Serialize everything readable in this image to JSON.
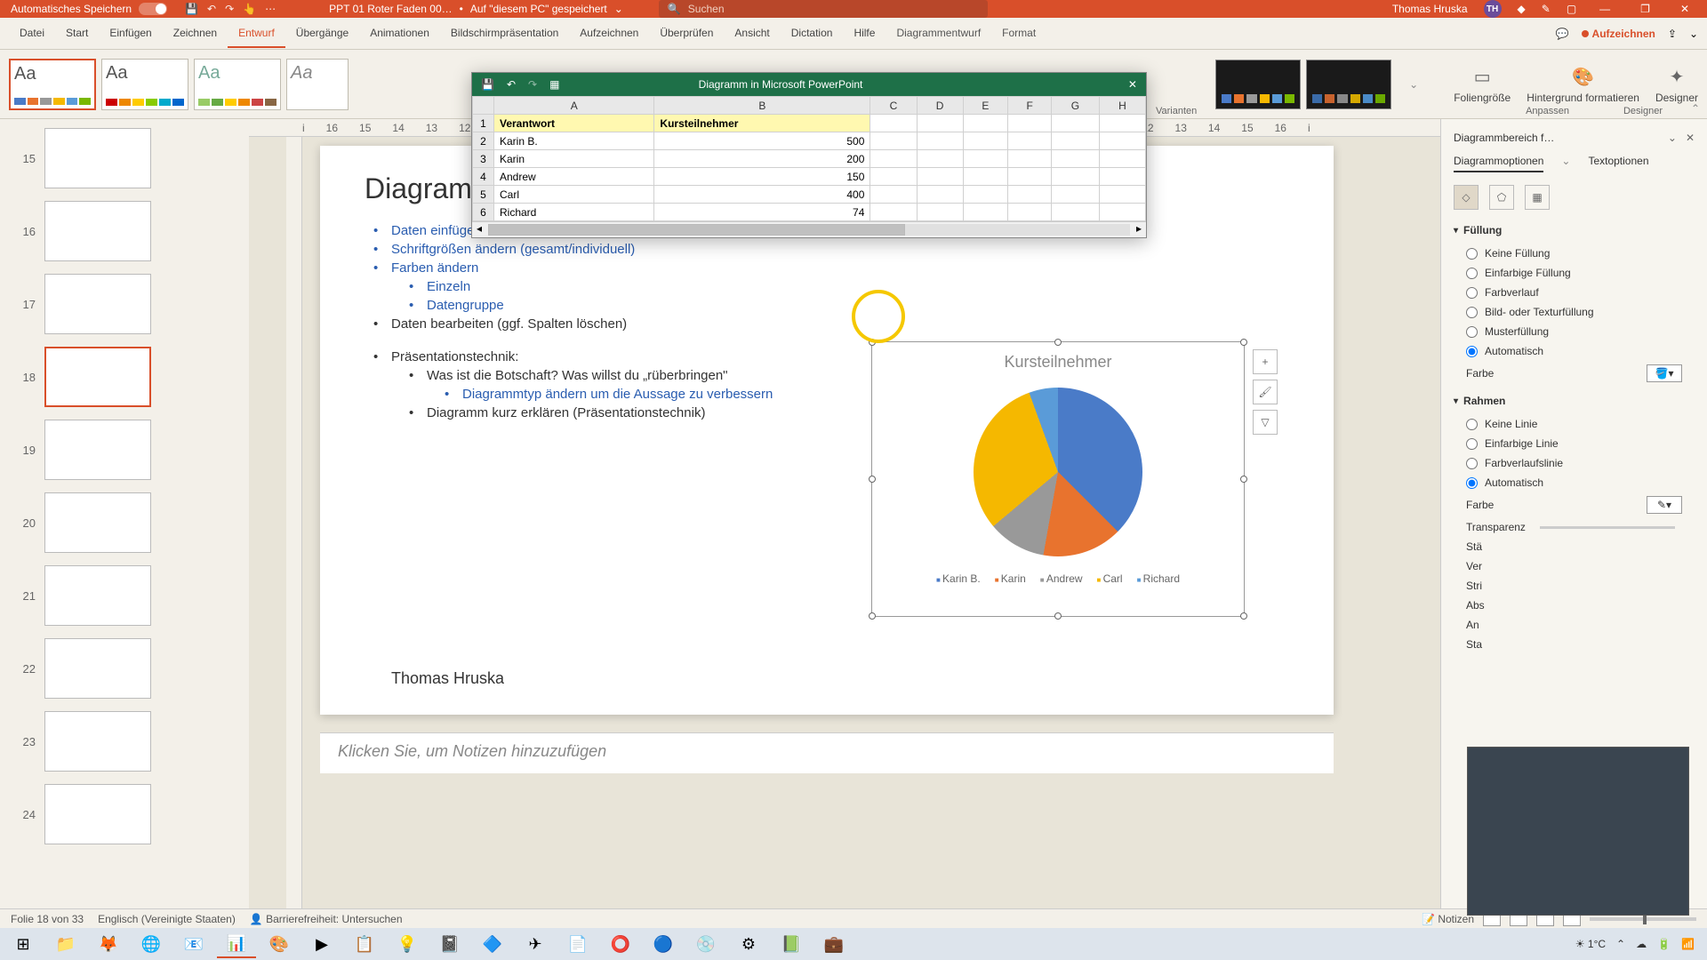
{
  "titlebar": {
    "autosave": "Automatisches Speichern",
    "doc": "PPT 01 Roter Faden 00…",
    "saved": "Auf \"diesem PC\" gespeichert",
    "search_ph": "Suchen",
    "user": "Thomas Hruska",
    "initials": "TH"
  },
  "tabs": [
    "Datei",
    "Start",
    "Einfügen",
    "Zeichnen",
    "Entwurf",
    "Übergänge",
    "Animationen",
    "Bildschirmpräsentation",
    "Aufzeichnen",
    "Überprüfen",
    "Ansicht",
    "Dictation",
    "Hilfe",
    "Diagrammentwurf",
    "Format"
  ],
  "active_tab": 4,
  "record": "Aufzeichnen",
  "ribbon": {
    "variants": "Varianten",
    "customize": "Anpassen",
    "designer_grp": "Designer",
    "slidesize": "Foliengröße",
    "formatbg": "Hintergrund formatieren",
    "designer": "Designer"
  },
  "excel": {
    "title": "Diagramm in Microsoft PowerPoint",
    "cols": [
      "A",
      "B",
      "C",
      "D",
      "E",
      "F",
      "G",
      "H"
    ],
    "headers": [
      "Verantwort",
      "Kursteilnehmer"
    ],
    "rows": [
      [
        "Karin B.",
        "500"
      ],
      [
        "Karin",
        "200"
      ],
      [
        "Andrew",
        "150"
      ],
      [
        "Carl",
        "400"
      ],
      [
        "Richard",
        "74"
      ]
    ]
  },
  "slide": {
    "title": "Diagramm e",
    "b1": "Daten einfügen",
    "b2": "Schriftgrößen ändern (gesamt/individuell)",
    "b3": "Farben ändern",
    "b3a": "Einzeln",
    "b3b": "Datengruppe",
    "b4": "Daten bearbeiten (ggf. Spalten löschen)",
    "b5": "Präsentationstechnik:",
    "b5a": "Was ist die Botschaft? Was willst du „rüberbringen\"",
    "b5a1": "Diagrammtyp ändern um die Aussage zu verbessern",
    "b5b": "Diagramm kurz erklären (Präsentationstechnik)",
    "author": "Thomas Hruska"
  },
  "chart_data": {
    "type": "pie",
    "title": "Kursteilnehmer",
    "categories": [
      "Karin B.",
      "Karin",
      "Andrew",
      "Carl",
      "Richard"
    ],
    "values": [
      500,
      200,
      150,
      400,
      74
    ]
  },
  "thumbs": [
    15,
    16,
    17,
    18,
    19,
    20,
    21,
    22,
    23,
    24
  ],
  "thumbs_sel": 18,
  "notes_ph": "Klicken Sie, um Notizen hinzuzufügen",
  "pane": {
    "title": "Diagrammbereich f…",
    "tab1": "Diagrammoptionen",
    "tab2": "Textoptionen",
    "fill": "Füllung",
    "f0": "Keine Füllung",
    "f1": "Einfarbige Füllung",
    "f2": "Farbverlauf",
    "f3": "Bild- oder Texturfüllung",
    "f4": "Musterfüllung",
    "f5": "Automatisch",
    "color": "Farbe",
    "border": "Rahmen",
    "r0": "Keine Linie",
    "r1": "Einfarbige Linie",
    "r2": "Farbverlaufslinie",
    "r3": "Automatisch",
    "transp": "Transparenz",
    "stk": "Stä",
    "ver": "Ver",
    "str": "Stri",
    "abs": "Abs",
    "ans": "An",
    "sta": "Sta"
  },
  "status": {
    "slide": "Folie 18 von 33",
    "lang": "Englisch (Vereinigte Staaten)",
    "access": "Barrierefreiheit: Untersuchen",
    "notes": "Notizen"
  },
  "taskbar": {
    "temp": "1°C",
    "time": ""
  }
}
